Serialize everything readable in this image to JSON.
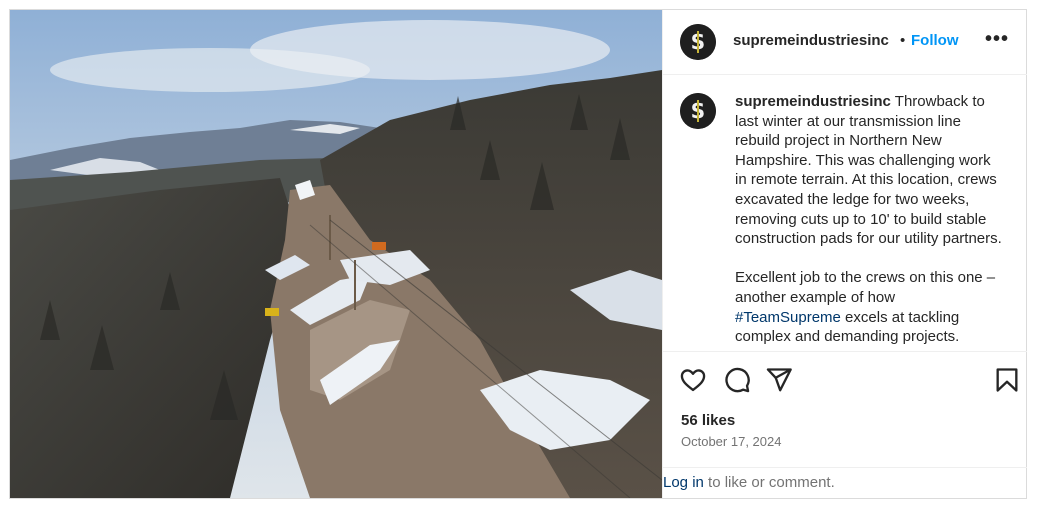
{
  "post": {
    "image_alt": "Aerial view of transmission line right-of-way construction on a snowy forested hillside",
    "account": {
      "username": "supremeindustriesinc",
      "follow_label": "Follow",
      "separator": "•",
      "more_label": "•••"
    },
    "caption": {
      "username": "supremeindustriesinc",
      "text_1": " Throwback to last winter at our transmission line rebuild project in Northern New Hampshire. This was challenging work in remote terrain. At this location, crews excavated the ledge for two weeks, removing cuts up to 10' to build stable construction pads for our utility partners.\n\nExcellent job to the crews on this one – another example of how ",
      "hashtag": "#TeamSupreme",
      "text_2": " excels at tackling complex and demanding projects."
    },
    "actions": {
      "like_icon": "heart-icon",
      "comment_icon": "comment-icon",
      "share_icon": "share-icon",
      "save_icon": "bookmark-icon"
    },
    "likes": "56 likes",
    "date": "October 17, 2024",
    "footer": {
      "login_label": "Log in",
      "rest": " to like or comment."
    },
    "colors": {
      "accent": "#0095f6",
      "link": "#00376b",
      "muted": "#737373",
      "text": "#262626"
    }
  }
}
